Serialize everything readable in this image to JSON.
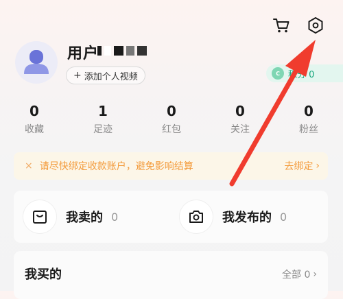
{
  "header": {
    "cart_icon": "shopping-cart-icon",
    "settings_icon": "settings-hex-icon"
  },
  "profile": {
    "username": "用户",
    "add_video_label": "添加个人视频",
    "points_label": "积分 0",
    "coin_mark": "C"
  },
  "stats": [
    {
      "value": "0",
      "label": "收藏"
    },
    {
      "value": "1",
      "label": "足迹"
    },
    {
      "value": "0",
      "label": "红包"
    },
    {
      "value": "0",
      "label": "关注"
    },
    {
      "value": "0",
      "label": "粉丝"
    }
  ],
  "banner": {
    "close": "×",
    "text": "请尽快绑定收款账户，避免影响结算",
    "link": "去绑定",
    "link_arrow": "›"
  },
  "sales": {
    "sold_label": "我卖的",
    "sold_count": "0",
    "published_label": "我发布的",
    "published_count": "0"
  },
  "purchases": {
    "title": "我买的",
    "all_label": "全部 0",
    "all_arrow": "›"
  },
  "colors": {
    "accent_orange": "#f39a3a",
    "points_green": "#13a57a",
    "annotation_red": "#f03c2e"
  }
}
